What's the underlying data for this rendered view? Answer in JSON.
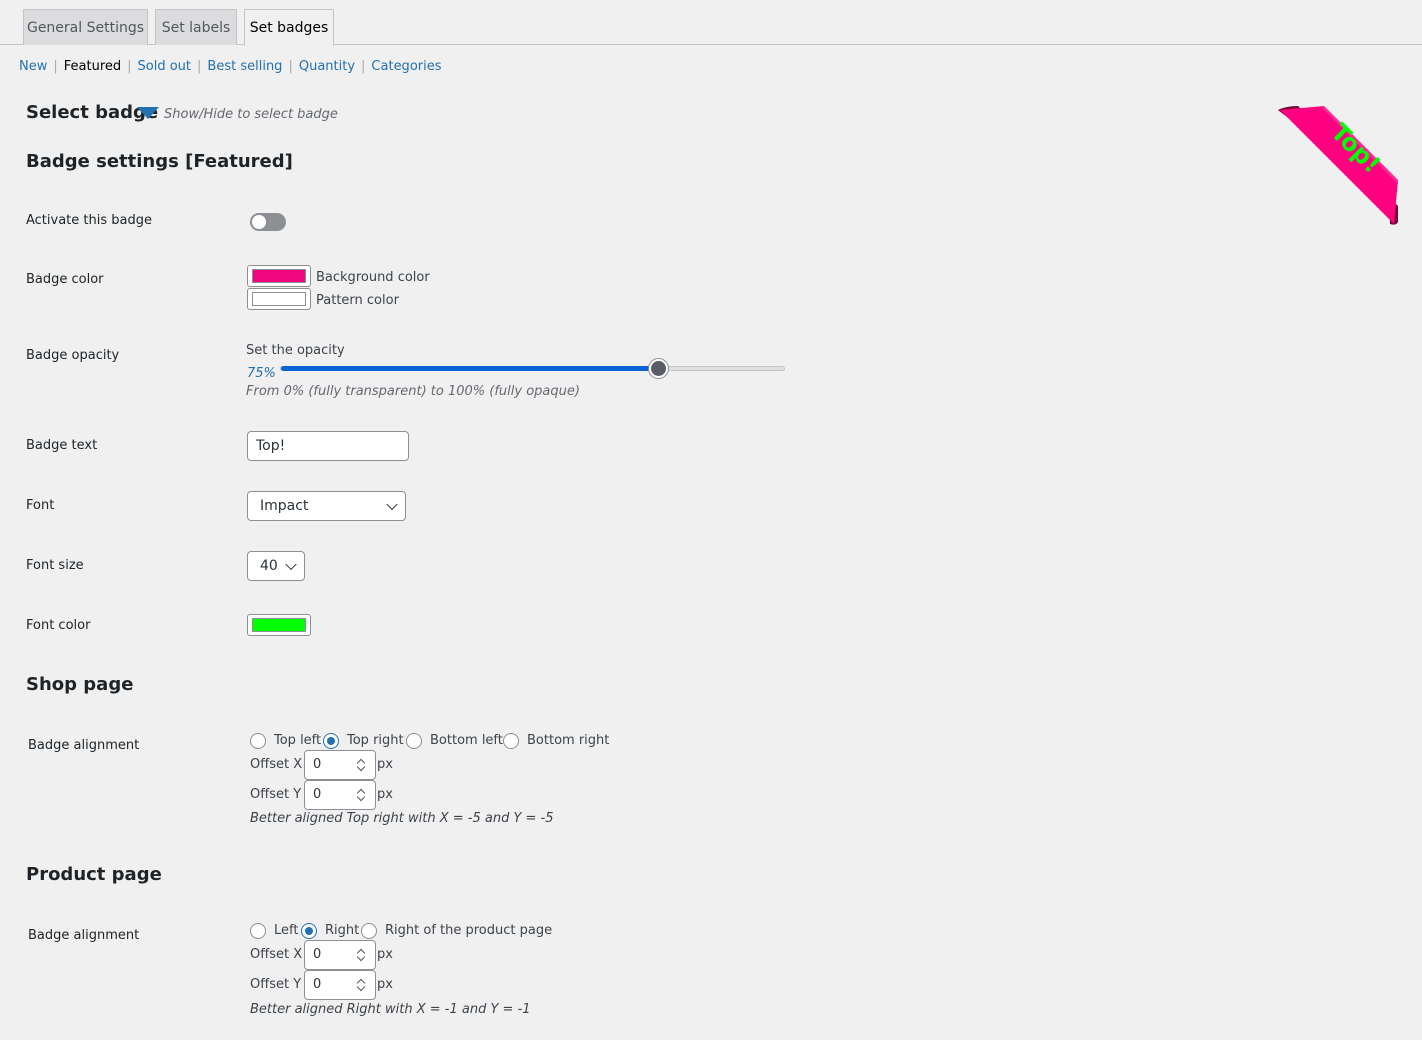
{
  "tabs": [
    {
      "label": "General Settings",
      "active": false
    },
    {
      "label": "Set labels",
      "active": false
    },
    {
      "label": "Set badges",
      "active": true
    }
  ],
  "subnav": {
    "items": [
      "New",
      "Featured",
      "Sold out",
      "Best selling",
      "Quantity",
      "Categories"
    ],
    "current": "Featured"
  },
  "select_badge": {
    "title": "Select badge",
    "hint": "Show/Hide to select badge"
  },
  "settings_title": "Badge settings [Featured]",
  "preview_badge": {
    "text": "Top!",
    "bg_color": "#ff0080",
    "text_color": "#00ff00"
  },
  "activate": {
    "label": "Activate this badge",
    "on": false
  },
  "badge_color": {
    "label": "Badge color",
    "background_label": "Background color",
    "background_value": "#f0077f",
    "pattern_label": "Pattern color",
    "pattern_value": "#ffffff"
  },
  "opacity": {
    "label": "Badge opacity",
    "caption": "Set the opacity",
    "value_text": "75%",
    "value": 75,
    "description": "From 0% (fully transparent) to 100% (fully opaque)"
  },
  "badge_text": {
    "label": "Badge text",
    "value": "Top!"
  },
  "font": {
    "label": "Font",
    "value": "Impact"
  },
  "font_size": {
    "label": "Font size",
    "value": "40"
  },
  "font_color": {
    "label": "Font color",
    "value": "#00ff00"
  },
  "shop_page": {
    "title": "Shop page",
    "alignment_label": "Badge alignment",
    "options": [
      "Top left",
      "Top right",
      "Bottom left",
      "Bottom right"
    ],
    "selected": "Top right",
    "offset_x_label": "Offset X",
    "offset_x": "0",
    "offset_y_label": "Offset Y",
    "offset_y": "0",
    "unit": "px",
    "hint": "Better aligned Top right with X = -5 and Y = -5"
  },
  "product_page": {
    "title": "Product page",
    "alignment_label": "Badge alignment",
    "options": [
      "Left",
      "Right",
      "Right of the product page"
    ],
    "selected": "Right",
    "offset_x_label": "Offset X",
    "offset_x": "0",
    "offset_y_label": "Offset Y",
    "offset_y": "0",
    "unit": "px",
    "hint": "Better aligned Right with X = -1 and Y = -1"
  },
  "icons": {
    "caret": "caret-down-icon",
    "chevron": "chevron-down-icon"
  }
}
